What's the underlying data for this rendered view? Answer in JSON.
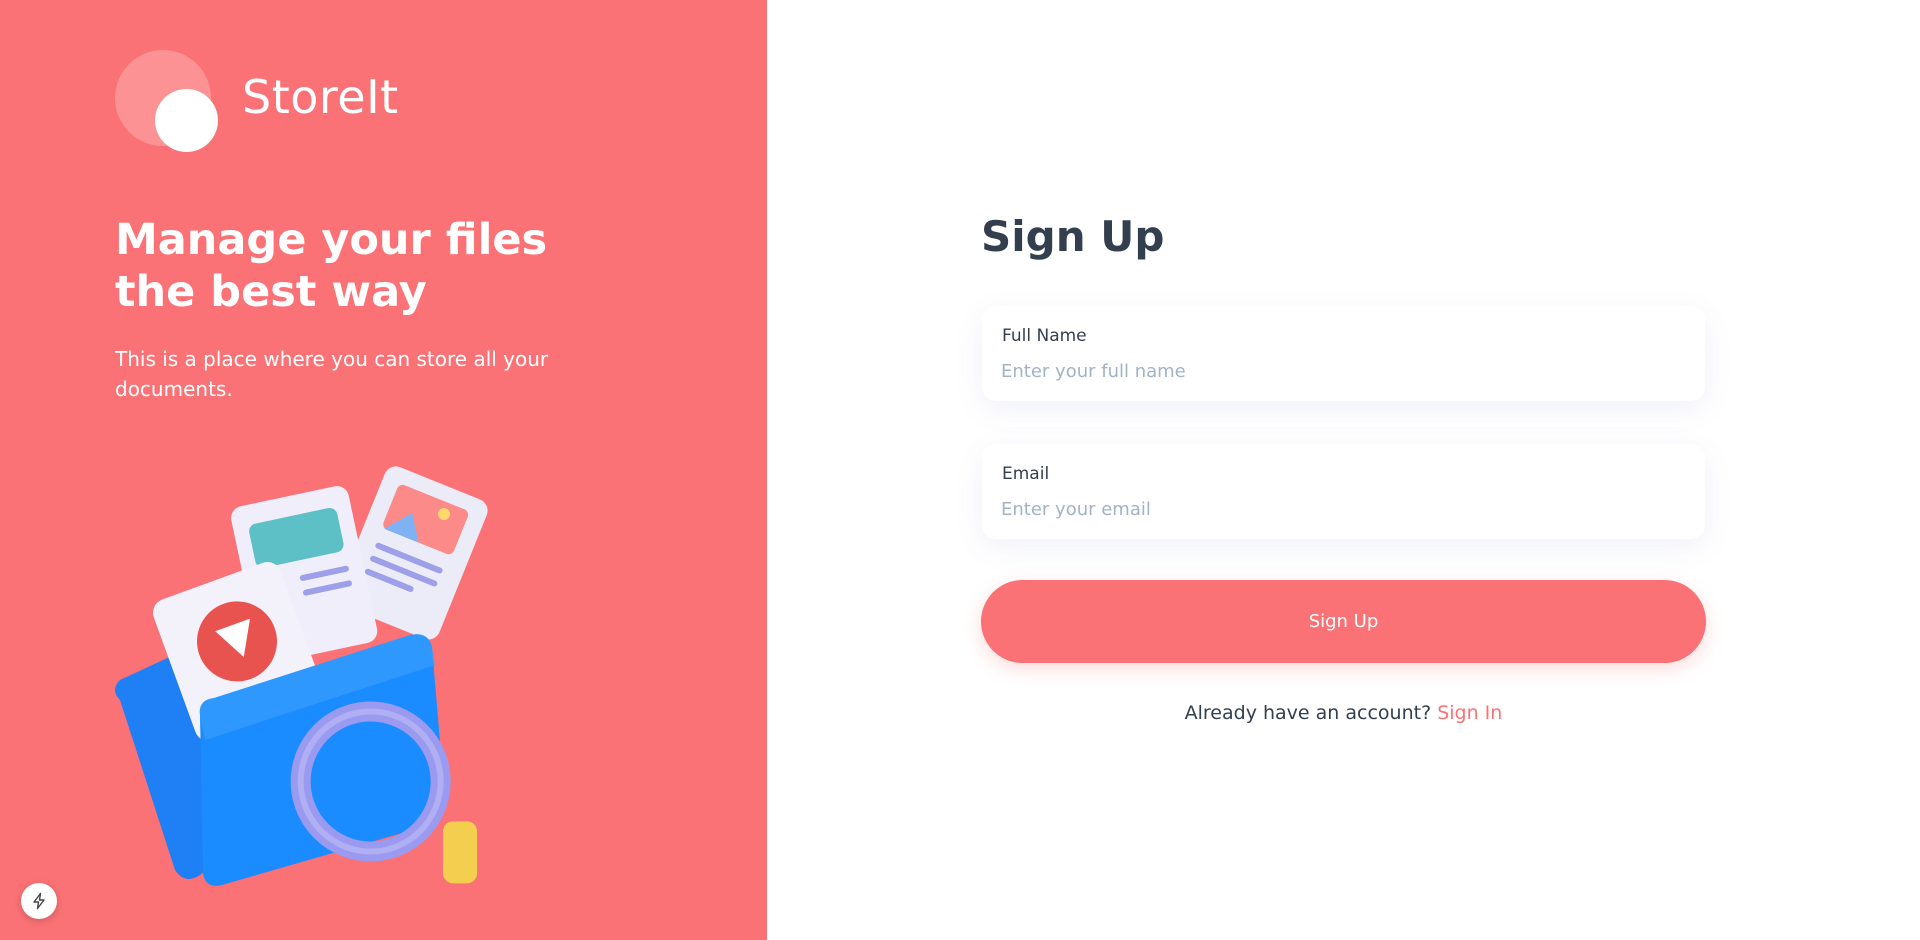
{
  "brand": {
    "name": "StoreIt",
    "colors": {
      "primary": "#fa7275",
      "text_dark": "#333f4e",
      "placeholder": "#a3b2c7"
    }
  },
  "hero": {
    "headline": "Manage your files the best way",
    "subtext": "This is a place where you can store all your documents."
  },
  "form": {
    "title": "Sign Up",
    "fields": [
      {
        "label": "Full Name",
        "placeholder": "Enter your full name",
        "value": ""
      },
      {
        "label": "Email",
        "placeholder": "Enter your email",
        "value": ""
      }
    ],
    "submit_label": "Sign Up",
    "footer_prompt": "Already have an account?",
    "footer_link": "Sign In"
  },
  "icons": {
    "dev_badge": "lightning-bolt-icon",
    "illustration": "files-folder-illustration"
  }
}
